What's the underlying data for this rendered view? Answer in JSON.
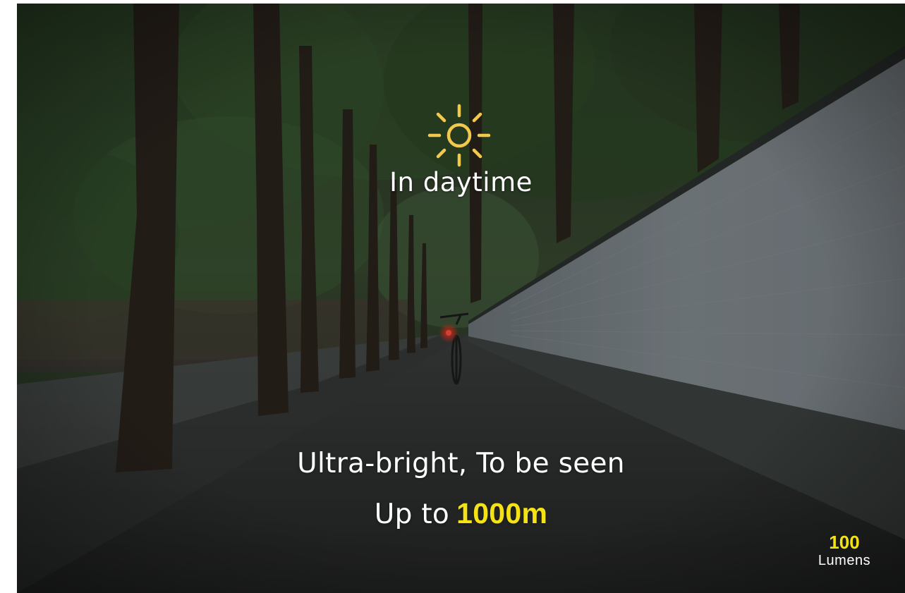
{
  "colors": {
    "accent": "#f5e216",
    "sun": "#f2c94c",
    "text": "#ffffff"
  },
  "icon": "sun-icon",
  "heading": "In daytime",
  "tagline": "Ultra-bright, To be seen",
  "range": {
    "prefix": "Up to",
    "value": "1000m"
  },
  "badge": {
    "value": "100",
    "unit": "Lumens"
  }
}
